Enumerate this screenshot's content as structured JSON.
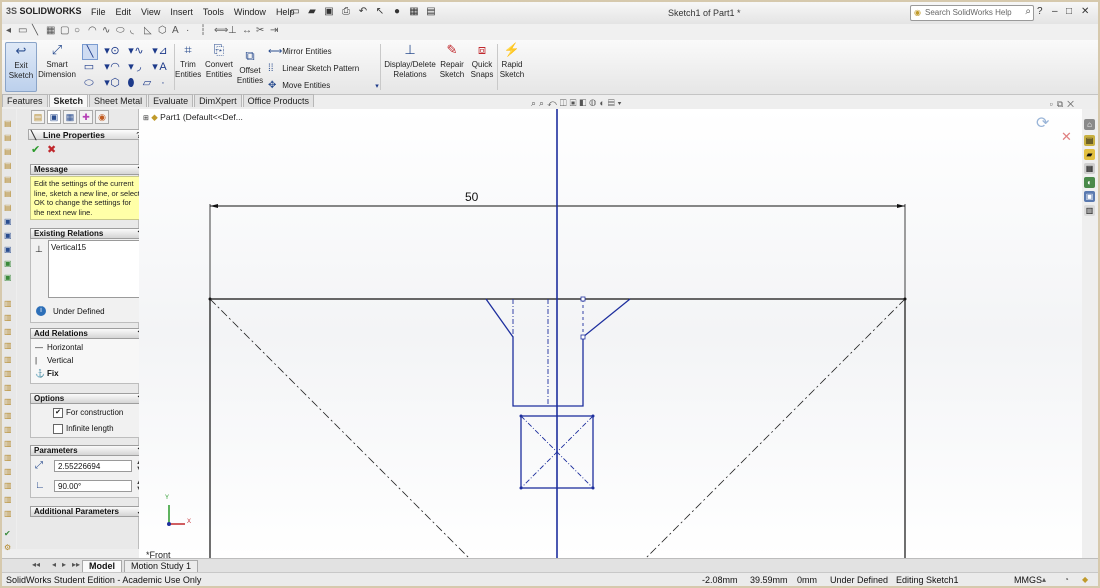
{
  "app": {
    "logo_prefix": "3S",
    "logo_name": "SOLIDWORKS",
    "document_title": "Sketch1 of Part1 *",
    "menu": [
      "File",
      "Edit",
      "View",
      "Insert",
      "Tools",
      "Window",
      "Help"
    ],
    "search_placeholder": "Search SolidWorks Help"
  },
  "command_manager": {
    "exit_sketch": [
      "Exit",
      "Sketch"
    ],
    "smart_dimension": [
      "Smart",
      "Dimension"
    ],
    "trim_entities": [
      "Trim",
      "Entities"
    ],
    "convert_entities": [
      "Convert",
      "Entities"
    ],
    "offset_entities": [
      "Offset",
      "Entities"
    ],
    "mirror_entities": "Mirror Entities",
    "linear_sketch_pattern": "Linear Sketch Pattern",
    "move_entities": "Move Entities",
    "display_delete_relations": [
      "Display/Delete",
      "Relations"
    ],
    "repair_sketch": [
      "Repair",
      "Sketch"
    ],
    "quick_snaps": [
      "Quick",
      "Snaps"
    ],
    "rapid_sketch": [
      "Rapid",
      "Sketch"
    ]
  },
  "tabs": [
    "Features",
    "Sketch",
    "Sheet Metal",
    "Evaluate",
    "DimXpert",
    "Office Products"
  ],
  "property_manager": {
    "title": "Line Properties",
    "message_header": "Message",
    "message_text": "Edit the settings of the current line, sketch a new line, or select OK to change the settings for the next new line.",
    "existing_relations_header": "Existing Relations",
    "existing_relations": [
      "Vertical15"
    ],
    "status": "Under Defined",
    "add_relations_header": "Add Relations",
    "add_relations": [
      "Horizontal",
      "Vertical",
      "Fix"
    ],
    "options_header": "Options",
    "options": {
      "for_construction": "For construction",
      "infinite_length": "Infinite length"
    },
    "parameters_header": "Parameters",
    "length_value": "2.55226694",
    "angle_value": "90.00°",
    "additional_parameters_header": "Additional Parameters"
  },
  "canvas": {
    "tree_node": "Part1  (Default<<Def...",
    "dimension_value": "50",
    "view_label": "*Front"
  },
  "bottom_tabs": [
    "Model",
    "Motion Study 1"
  ],
  "status_bar": {
    "edition": "SolidWorks Student Edition - Academic Use Only",
    "x": "-2.08mm",
    "y": "39.59mm",
    "z": "0mm",
    "state": "Under Defined",
    "editing": "Editing Sketch1",
    "units": "MMGS"
  },
  "colors": {
    "sketch_blue": "#1e2f9e",
    "sketch_black": "#111111",
    "message_bg": "#ffffa8"
  }
}
